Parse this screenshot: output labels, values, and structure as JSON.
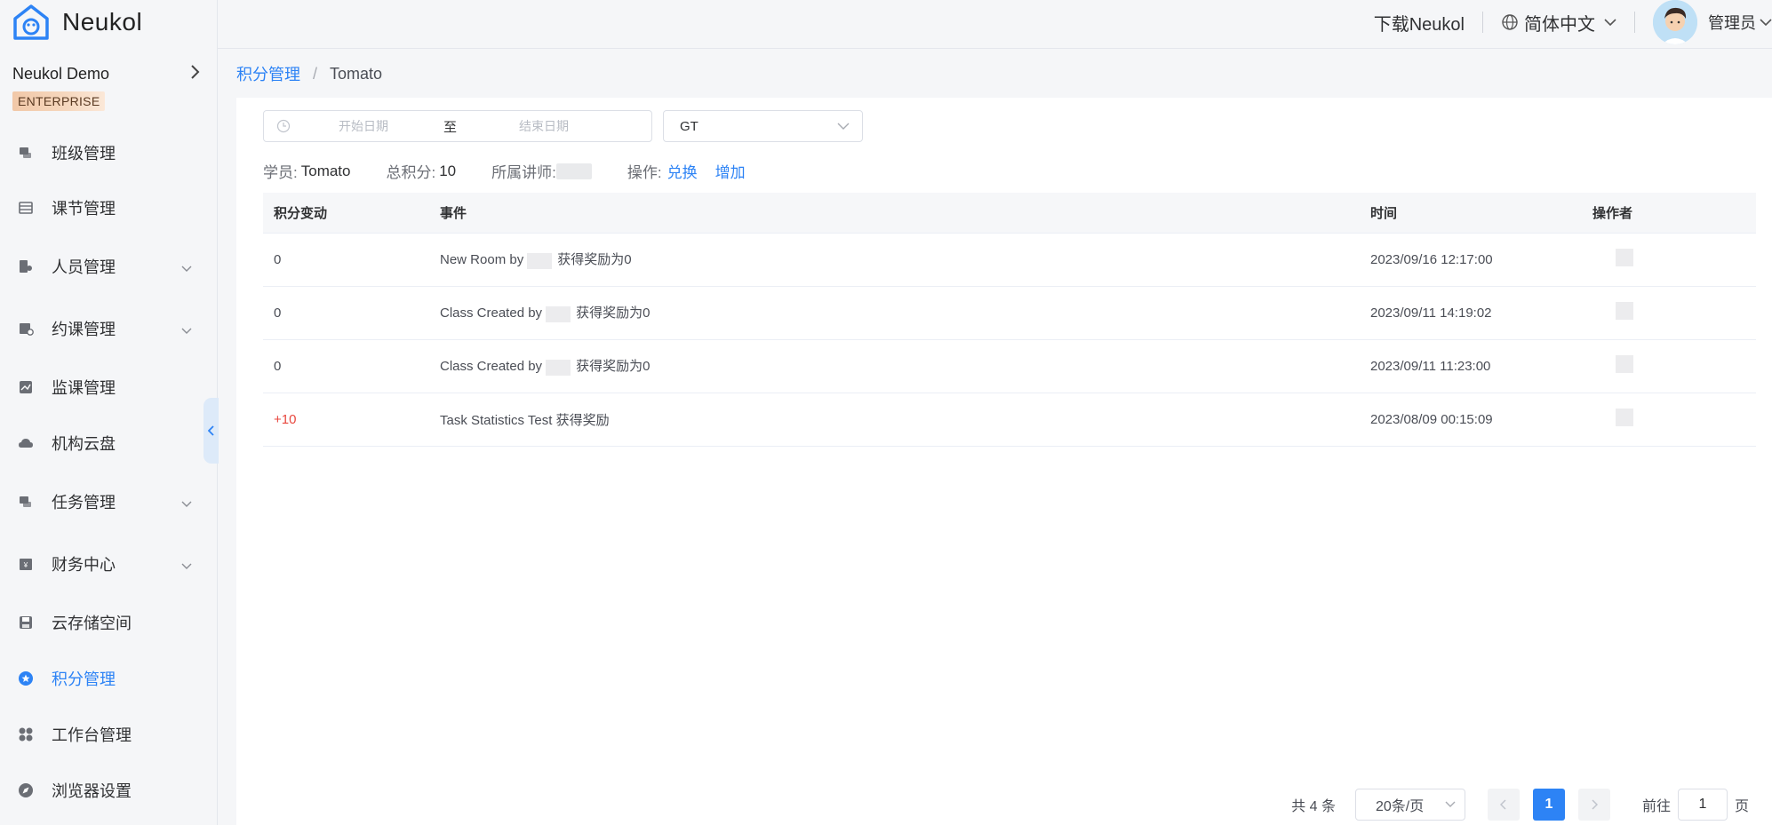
{
  "app": {
    "name": "Neukol"
  },
  "org": {
    "name": "Neukol Demo",
    "plan_badge": "ENTERPRISE"
  },
  "sidebar": {
    "items": [
      {
        "label": "班级管理",
        "icon": "class-icon",
        "expandable": false
      },
      {
        "label": "课节管理",
        "icon": "lesson-icon",
        "expandable": false
      },
      {
        "label": "人员管理",
        "icon": "people-icon",
        "expandable": true
      },
      {
        "label": "约课管理",
        "icon": "booking-icon",
        "expandable": true
      },
      {
        "label": "监课管理",
        "icon": "monitor-icon",
        "expandable": false
      },
      {
        "label": "机构云盘",
        "icon": "cloud-icon",
        "expandable": false
      },
      {
        "label": "任务管理",
        "icon": "task-icon",
        "expandable": true
      },
      {
        "label": "财务中心",
        "icon": "finance-icon",
        "expandable": true
      },
      {
        "label": "云存储空间",
        "icon": "storage-icon",
        "expandable": false
      },
      {
        "label": "积分管理",
        "icon": "points-icon",
        "expandable": false,
        "active": true
      },
      {
        "label": "工作台管理",
        "icon": "workbench-icon",
        "expandable": false
      },
      {
        "label": "浏览器设置",
        "icon": "compass-icon",
        "expandable": false
      }
    ]
  },
  "header": {
    "download": "下载Neukol",
    "language": "简体中文",
    "user": "管理员"
  },
  "breadcrumb": {
    "parent": "积分管理",
    "current": "Tomato"
  },
  "filters": {
    "start_placeholder": "开始日期",
    "to": "至",
    "end_placeholder": "结束日期",
    "select_value": "GT"
  },
  "info": {
    "student_label": "学员:",
    "student": "Tomato",
    "total_label": "总积分:",
    "total": "10",
    "teacher_label": "所属讲师:",
    "action_label": "操作:",
    "exchange": "兑换",
    "add": "增加"
  },
  "table": {
    "columns": [
      "积分变动",
      "事件",
      "时间",
      "操作者"
    ],
    "rows": [
      {
        "change": "0",
        "event_prefix": "New Room by",
        "event_suffix": "获得奖励为0",
        "time": "2023/09/16 12:17:00",
        "positive": false
      },
      {
        "change": "0",
        "event_prefix": "Class Created by",
        "event_suffix": "获得奖励为0",
        "time": "2023/09/11 14:19:02",
        "positive": false
      },
      {
        "change": "0",
        "event_prefix": "Class Created by",
        "event_suffix": "获得奖励为0",
        "time": "2023/09/11 11:23:00",
        "positive": false
      },
      {
        "change": "+10",
        "event_prefix": "Task Statistics Test 获得奖励",
        "event_suffix": "",
        "time": "2023/08/09 00:15:09",
        "positive": true
      }
    ]
  },
  "pagination": {
    "total": "共 4 条",
    "page_size": "20条/页",
    "current": "1",
    "goto_label": "前往",
    "goto_value": "1",
    "page_suffix": "页"
  },
  "colors": {
    "accent": "#2d83f5",
    "positive": "#e8473e"
  }
}
